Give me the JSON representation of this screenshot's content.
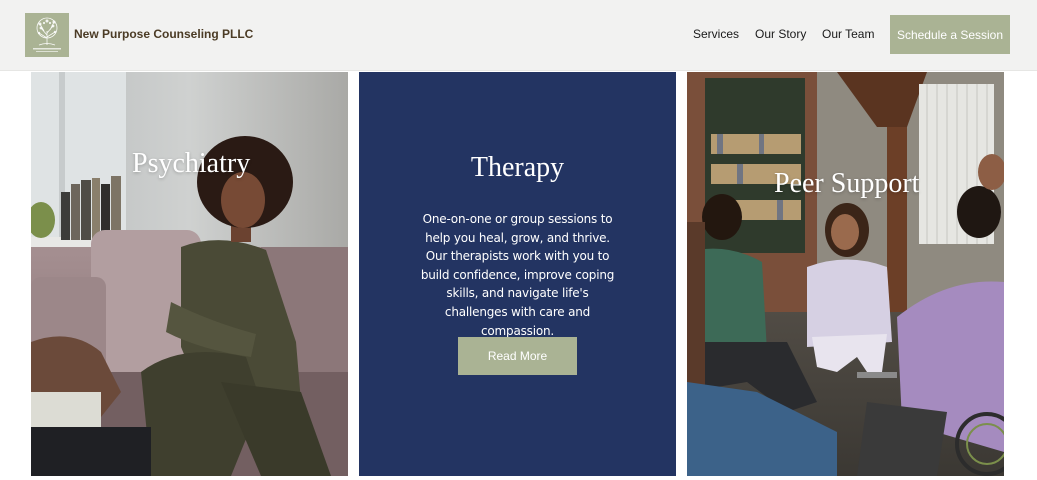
{
  "header": {
    "brand": "New Purpose Counseling PLLC",
    "logo_icon": "tree-logo-icon",
    "nav": {
      "services": "Services",
      "our_story": "Our Story",
      "our_team": "Our Team"
    },
    "cta": "Schedule a Session"
  },
  "cards": {
    "psychiatry": {
      "title": "Psychiatry"
    },
    "therapy": {
      "title": "Therapy",
      "description": "One-on-one or group sessions to help you heal, grow, and thrive. Our therapists work with you to build confidence, improve coping skills, and navigate life's challenges with care and compassion.",
      "button": "Read More"
    },
    "peer_support": {
      "title": "Peer Support"
    }
  },
  "colors": {
    "header_bg": "#f2f2f1",
    "accent": "#aab394",
    "brand_text": "#4b3b25",
    "therapy_bg": "#233462"
  }
}
